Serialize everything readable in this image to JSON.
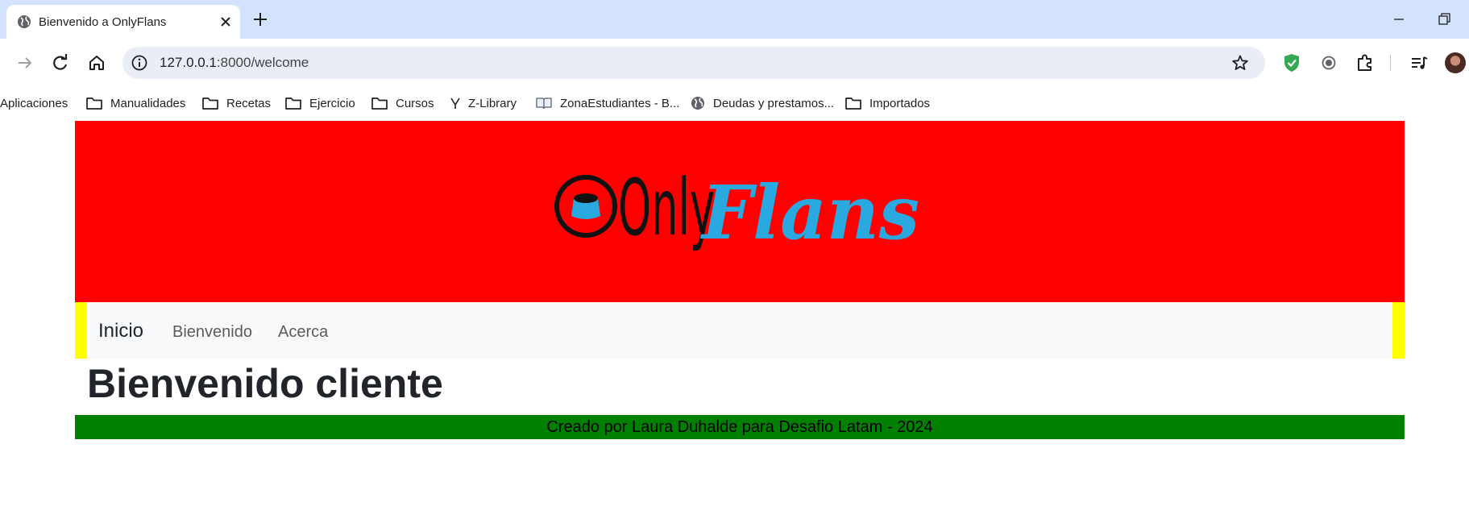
{
  "browser": {
    "tab": {
      "title": "Bienvenido a OnlyFlans"
    },
    "address": {
      "host": "127.0.0.1",
      "path": ":8000/welcome"
    },
    "bookmarks": [
      {
        "label": "Aplicaciones",
        "icon": "apps-icon"
      },
      {
        "label": "Manualidades",
        "icon": "folder-icon"
      },
      {
        "label": "Recetas",
        "icon": "folder-icon"
      },
      {
        "label": "Ejercicio",
        "icon": "folder-icon"
      },
      {
        "label": "Cursos",
        "icon": "folder-icon"
      },
      {
        "label": "Z-Library",
        "icon": "zlibrary-icon"
      },
      {
        "label": "ZonaEstudiantes - B...",
        "icon": "book-icon"
      },
      {
        "label": "Deudas y prestamos...",
        "icon": "globe-icon"
      },
      {
        "label": "Importados",
        "icon": "folder-icon"
      }
    ]
  },
  "header": {
    "logo": {
      "word_plain": "Only",
      "word_script": "Flans"
    },
    "background": "#ff0000"
  },
  "nav": {
    "brand": "Inicio",
    "links": [
      "Bienvenido",
      "Acerca"
    ],
    "border_color": "#ffff00"
  },
  "main": {
    "heading": "Bienvenido cliente"
  },
  "footer": {
    "text": "Creado por Laura Duhalde para Desafio Latam - 2024",
    "background": "#008000"
  },
  "colors": {
    "logo_blue": "#29a9e0",
    "chrome_tabstrip": "#d3e3fd"
  }
}
